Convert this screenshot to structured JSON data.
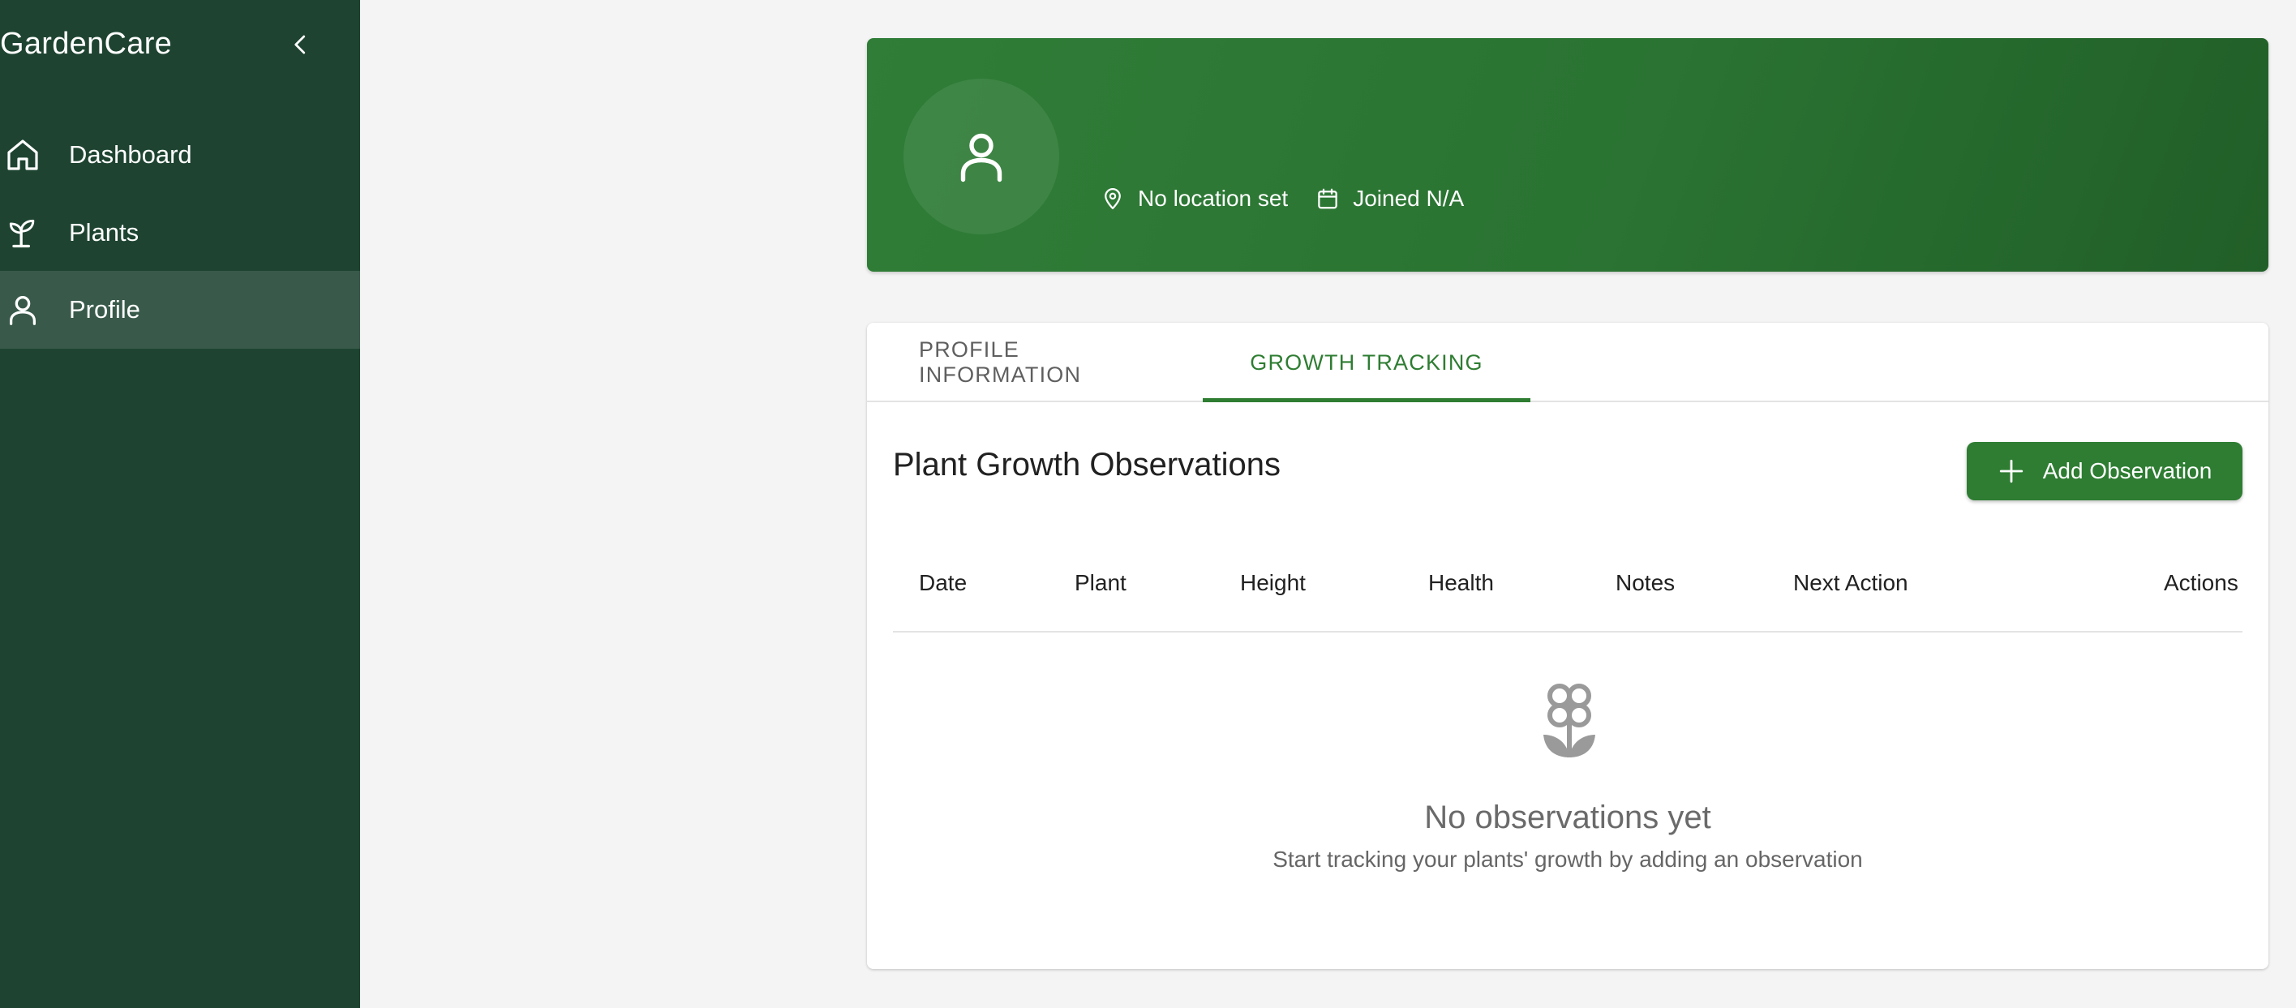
{
  "sidebar": {
    "brand": "GardenCare",
    "items": [
      {
        "label": "Dashboard",
        "icon": "home-icon"
      },
      {
        "label": "Plants",
        "icon": "sprout-icon"
      },
      {
        "label": "Profile",
        "icon": "person-icon",
        "active": true
      }
    ]
  },
  "header": {
    "location": "No location set",
    "joined": "Joined N/A"
  },
  "tabs": [
    {
      "label": "PROFILE INFORMATION",
      "active": false
    },
    {
      "label": "GROWTH TRACKING",
      "active": true
    }
  ],
  "growth": {
    "title": "Plant Growth Observations",
    "add_button": "Add Observation",
    "columns": [
      "Date",
      "Plant",
      "Height",
      "Health",
      "Notes",
      "Next Action",
      "Actions"
    ],
    "empty_title": "No observations yet",
    "empty_subtitle": "Start tracking your plants' growth by adding an observation"
  },
  "colors": {
    "sidebar_bg": "#1e4431",
    "accent": "#2e7d32",
    "page_bg": "#f4f4f4"
  }
}
